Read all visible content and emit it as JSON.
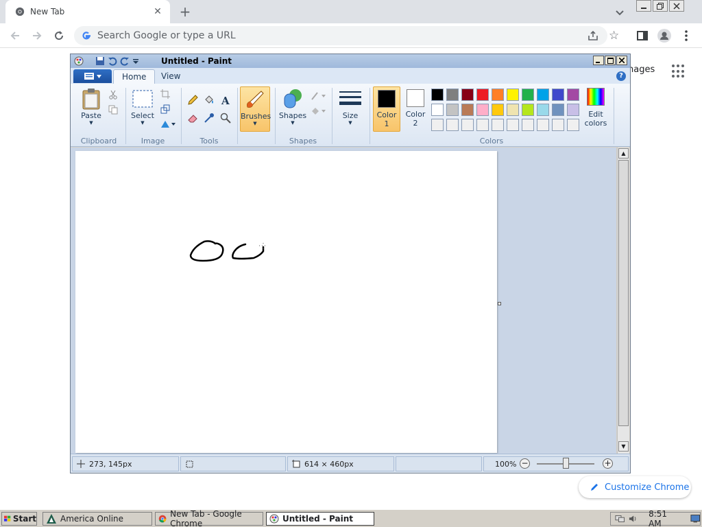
{
  "chrome": {
    "tab_title": "New Tab",
    "tab_close": "✕",
    "new_tab": "+",
    "omnibox_placeholder": "Search Google or type a URL",
    "images_link": "nages",
    "customize_label": "Customize Chrome"
  },
  "paint": {
    "title": "Untitled - Paint",
    "tabs": {
      "home": "Home",
      "view": "View"
    },
    "help": "?",
    "groups": {
      "clipboard": "Clipboard",
      "image": "Image",
      "tools": "Tools",
      "shapes": "Shapes",
      "colors": "Colors"
    },
    "buttons": {
      "paste": "Paste",
      "select": "Select",
      "brushes": "Brushes",
      "shapes": "Shapes",
      "size": "Size",
      "color1_line1": "Color",
      "color1_line2": "1",
      "color2_line1": "Color",
      "color2_line2": "2",
      "edit_colors_line1": "Edit",
      "edit_colors_line2": "colors"
    },
    "color1": "#000000",
    "color2": "#ffffff",
    "palette": [
      "#000000",
      "#7f7f7f",
      "#880015",
      "#ed1c24",
      "#ff7f27",
      "#fff200",
      "#22b14c",
      "#00a2e8",
      "#3f48cc",
      "#a349a4",
      "#ffffff",
      "#c3c3c3",
      "#b97a57",
      "#ffaec9",
      "#ffc90e",
      "#efe4b0",
      "#b5e61d",
      "#99d9ea",
      "#7092be",
      "#c8bfe7",
      "#f0f0f0",
      "#f0f0f0",
      "#f0f0f0",
      "#f0f0f0",
      "#f0f0f0",
      "#f0f0f0",
      "#f0f0f0",
      "#f0f0f0",
      "#f0f0f0",
      "#f0f0f0"
    ],
    "status": {
      "cursor_pos": "273, 145px",
      "canvas_size": "614 × 460px",
      "zoom": "100%",
      "zoom_minus": "−",
      "zoom_plus": "+"
    }
  },
  "taskbar": {
    "start": "Start",
    "tasks": [
      "America  Online",
      "New Tab - Google Chrome",
      "Untitled - Paint"
    ],
    "clock": "8:51 AM"
  }
}
